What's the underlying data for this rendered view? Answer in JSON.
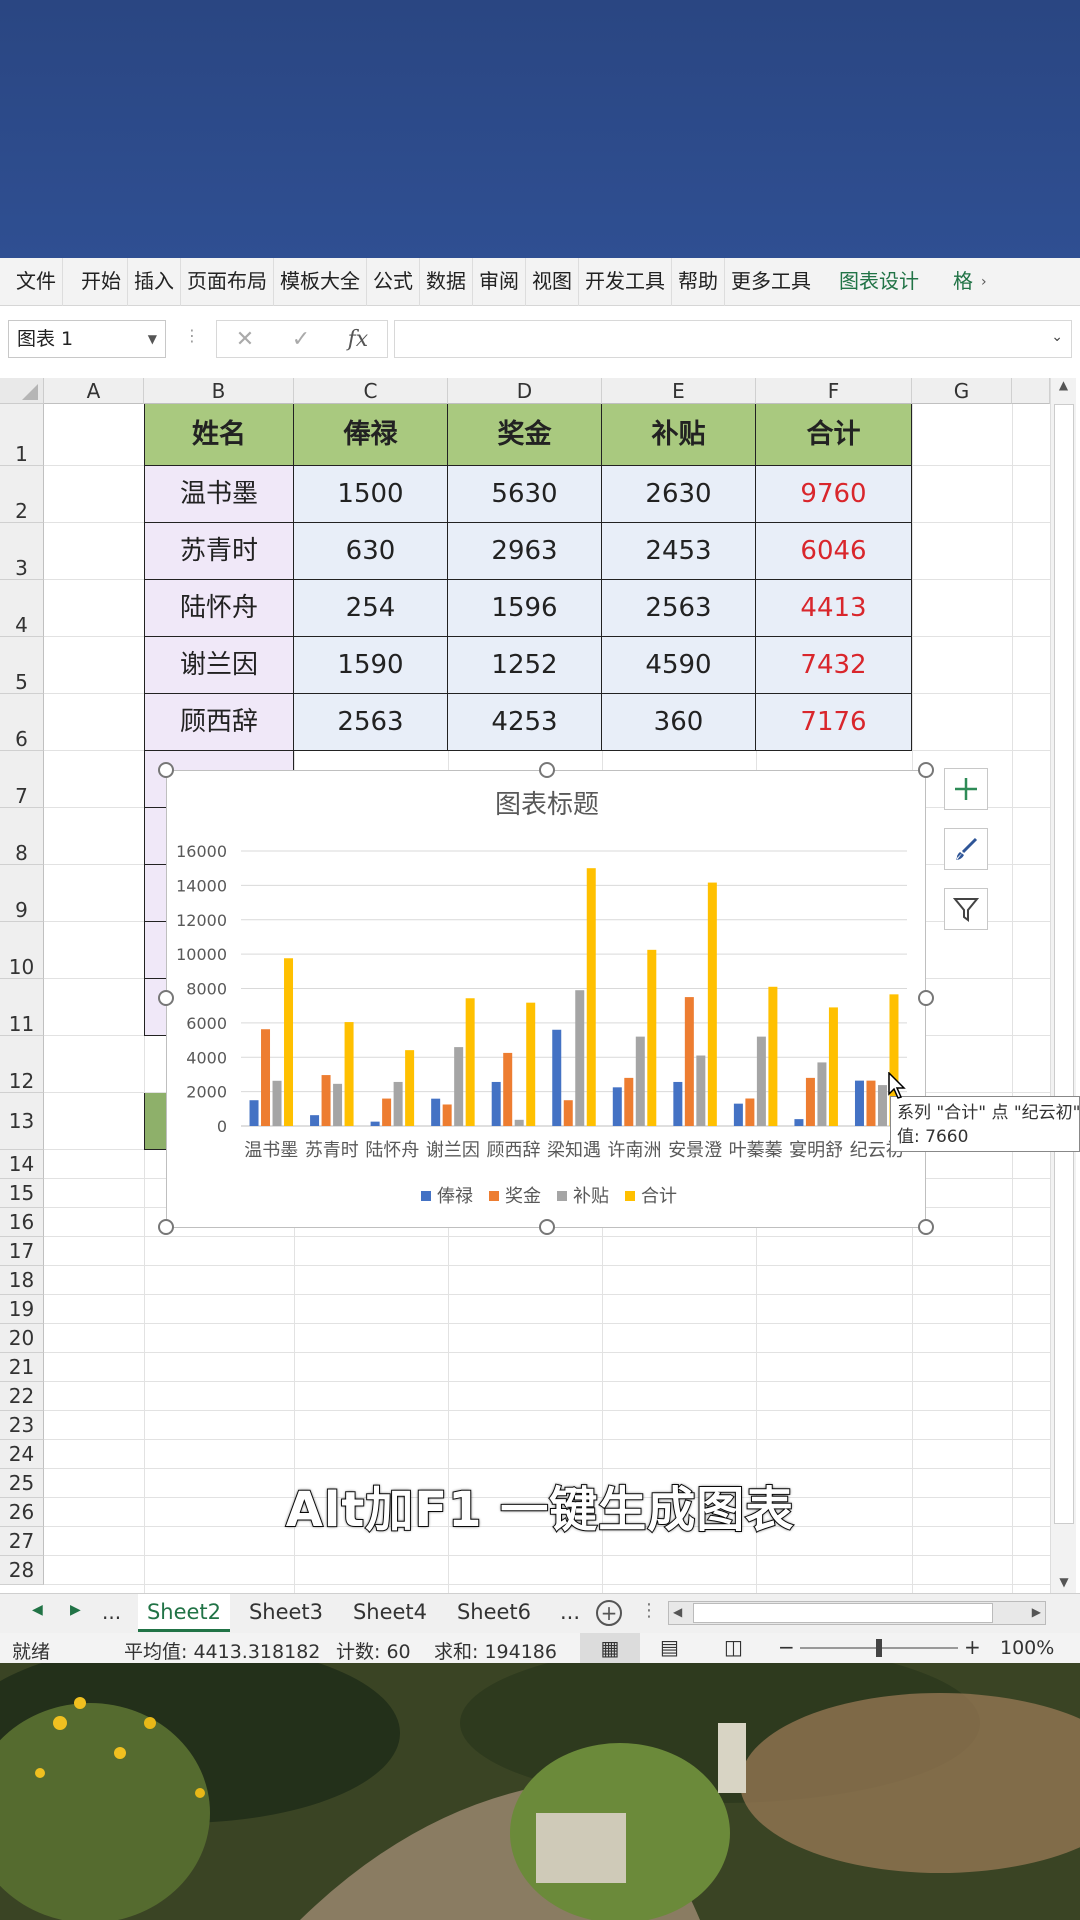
{
  "ribbon": {
    "tabs": [
      "文件",
      "开始",
      "插入",
      "页面布局",
      "模板大全",
      "公式",
      "数据",
      "审阅",
      "视图",
      "开发工具",
      "帮助",
      "更多工具"
    ],
    "chart_design": "图表设计",
    "format": "格"
  },
  "formula_bar": {
    "name_box": "图表 1",
    "fx": "fx",
    "value": ""
  },
  "columns": [
    "A",
    "B",
    "C",
    "D",
    "E",
    "F",
    "G"
  ],
  "rows": [
    "1",
    "2",
    "3",
    "4",
    "5",
    "6",
    "7",
    "8",
    "9",
    "10",
    "11",
    "12",
    "13",
    "14",
    "15",
    "16",
    "17",
    "18",
    "19",
    "20",
    "21",
    "22",
    "23",
    "24",
    "25",
    "26",
    "27",
    "28"
  ],
  "table": {
    "headers": [
      "姓名",
      "俸禄",
      "奖金",
      "补贴",
      "合计"
    ],
    "rows": [
      [
        "温书墨",
        "1500",
        "5630",
        "2630",
        "9760"
      ],
      [
        "苏青时",
        "630",
        "2963",
        "2453",
        "6046"
      ],
      [
        "陆怀舟",
        "254",
        "1596",
        "2563",
        "4413"
      ],
      [
        "谢兰因",
        "1590",
        "1252",
        "4590",
        "7432"
      ],
      [
        "顾西辞",
        "2563",
        "4253",
        "360",
        "7176"
      ]
    ]
  },
  "chart_data": {
    "type": "bar",
    "title": "图表标题",
    "categories": [
      "温书墨",
      "苏青时",
      "陆怀舟",
      "谢兰因",
      "顾西辞",
      "梁知遇",
      "许南洲",
      "安景澄",
      "叶蓁蓁",
      "宴明舒",
      "纪云初"
    ],
    "series": [
      {
        "name": "俸禄",
        "color": "#4472c4",
        "values": [
          1500,
          630,
          254,
          1590,
          2563,
          5600,
          2250,
          2563,
          1300,
          400,
          2640
        ]
      },
      {
        "name": "奖金",
        "color": "#ed7d31",
        "values": [
          5630,
          2963,
          1596,
          1252,
          4253,
          1500,
          2800,
          7500,
          1600,
          2800,
          2640
        ]
      },
      {
        "name": "补贴",
        "color": "#a5a5a5",
        "values": [
          2630,
          2453,
          2563,
          4590,
          360,
          7900,
          5200,
          4100,
          5200,
          3700,
          2380
        ]
      },
      {
        "name": "合计",
        "color": "#ffc000",
        "values": [
          9760,
          6046,
          4413,
          7432,
          7176,
          15000,
          10250,
          14163,
          8100,
          6900,
          7660
        ]
      }
    ],
    "ylim": [
      0,
      16000
    ],
    "yticks": [
      "0",
      "2000",
      "4000",
      "6000",
      "8000",
      "10000",
      "12000",
      "14000",
      "16000"
    ],
    "grid": true,
    "legend": "bottom"
  },
  "tooltip": {
    "line1": "系列 \"合计\" 点 \"纪云初\"",
    "line2": "值: 7660"
  },
  "sheets": {
    "nav_more": "...",
    "tabs": [
      "Sheet2",
      "Sheet3",
      "Sheet4",
      "Sheet6"
    ],
    "active": "Sheet2",
    "more": "..."
  },
  "status": {
    "ready": "就绪",
    "average": "平均值: 4413.318182",
    "count": "计数: 60",
    "sum": "求和: 194186",
    "zoom": "100%"
  },
  "subtitle": "Alt加F1 一键生成图表"
}
